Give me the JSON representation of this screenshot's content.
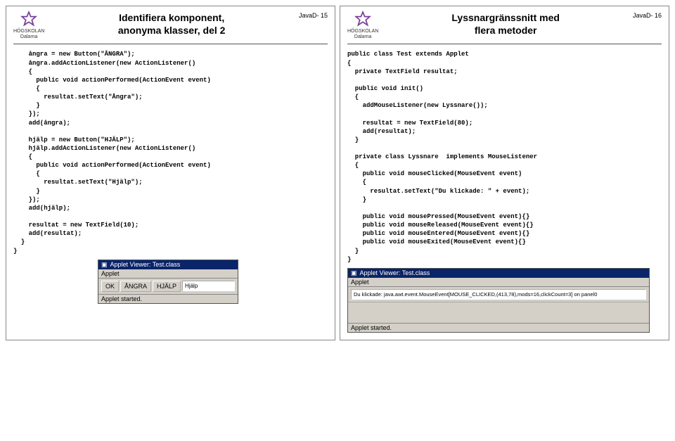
{
  "logo": {
    "line1": "HÖGSKOLAN",
    "line2": "Dalarna"
  },
  "left": {
    "num": "JavaD- 15",
    "title": "Identifiera komponent,\nanonyma klasser, del 2",
    "code": "    ångra = new Button(\"ÅNGRA\");\n    ångra.addActionListener(new ActionListener()\n    {\n      public void actionPerformed(ActionEvent event)\n      {\n        resultat.setText(\"Ångra\");\n      }\n    });\n    add(ångra);\n\n    hjälp = new Button(\"HJÄLP\");\n    hjälp.addActionListener(new ActionListener()\n    {\n      public void actionPerformed(ActionEvent event)\n      {\n        resultat.setText(\"Hjälp\");\n      }\n    });\n    add(hjälp);\n\n    resultat = new TextField(10);\n    add(resultat);\n  }\n}",
    "applet": {
      "title": "Applet Viewer: Test.class",
      "menu": "Applet",
      "buttons": [
        "OK",
        "ÅNGRA",
        "HJÄLP"
      ],
      "field": "Hjälp",
      "status": "Applet started."
    }
  },
  "right": {
    "num": "JavaD- 16",
    "title": "Lyssnargränssnitt med\nflera metoder",
    "code": "public class Test extends Applet\n{\n  private TextField resultat;\n\n  public void init()\n  {\n    addMouseListener(new Lyssnare());\n\n    resultat = new TextField(80);\n    add(resultat);\n  }\n\n  private class Lyssnare  implements MouseListener\n  {\n    public void mouseClicked(MouseEvent event)\n    {\n      resultat.setText(\"Du klickade: \" + event);\n    }\n\n    public void mousePressed(MouseEvent event){}\n    public void mouseReleased(MouseEvent event){}\n    public void mouseEntered(MouseEvent event){}\n    public void mouseExited(MouseEvent event){}\n  }\n}",
    "applet": {
      "title": "Applet Viewer: Test.class",
      "menu": "Applet",
      "field": "Du klickade: java.awt.event.MouseEvent[MOUSE_CLICKED,(413,78),mods=16,clickCount=3] on panel0",
      "status": "Applet started."
    }
  }
}
